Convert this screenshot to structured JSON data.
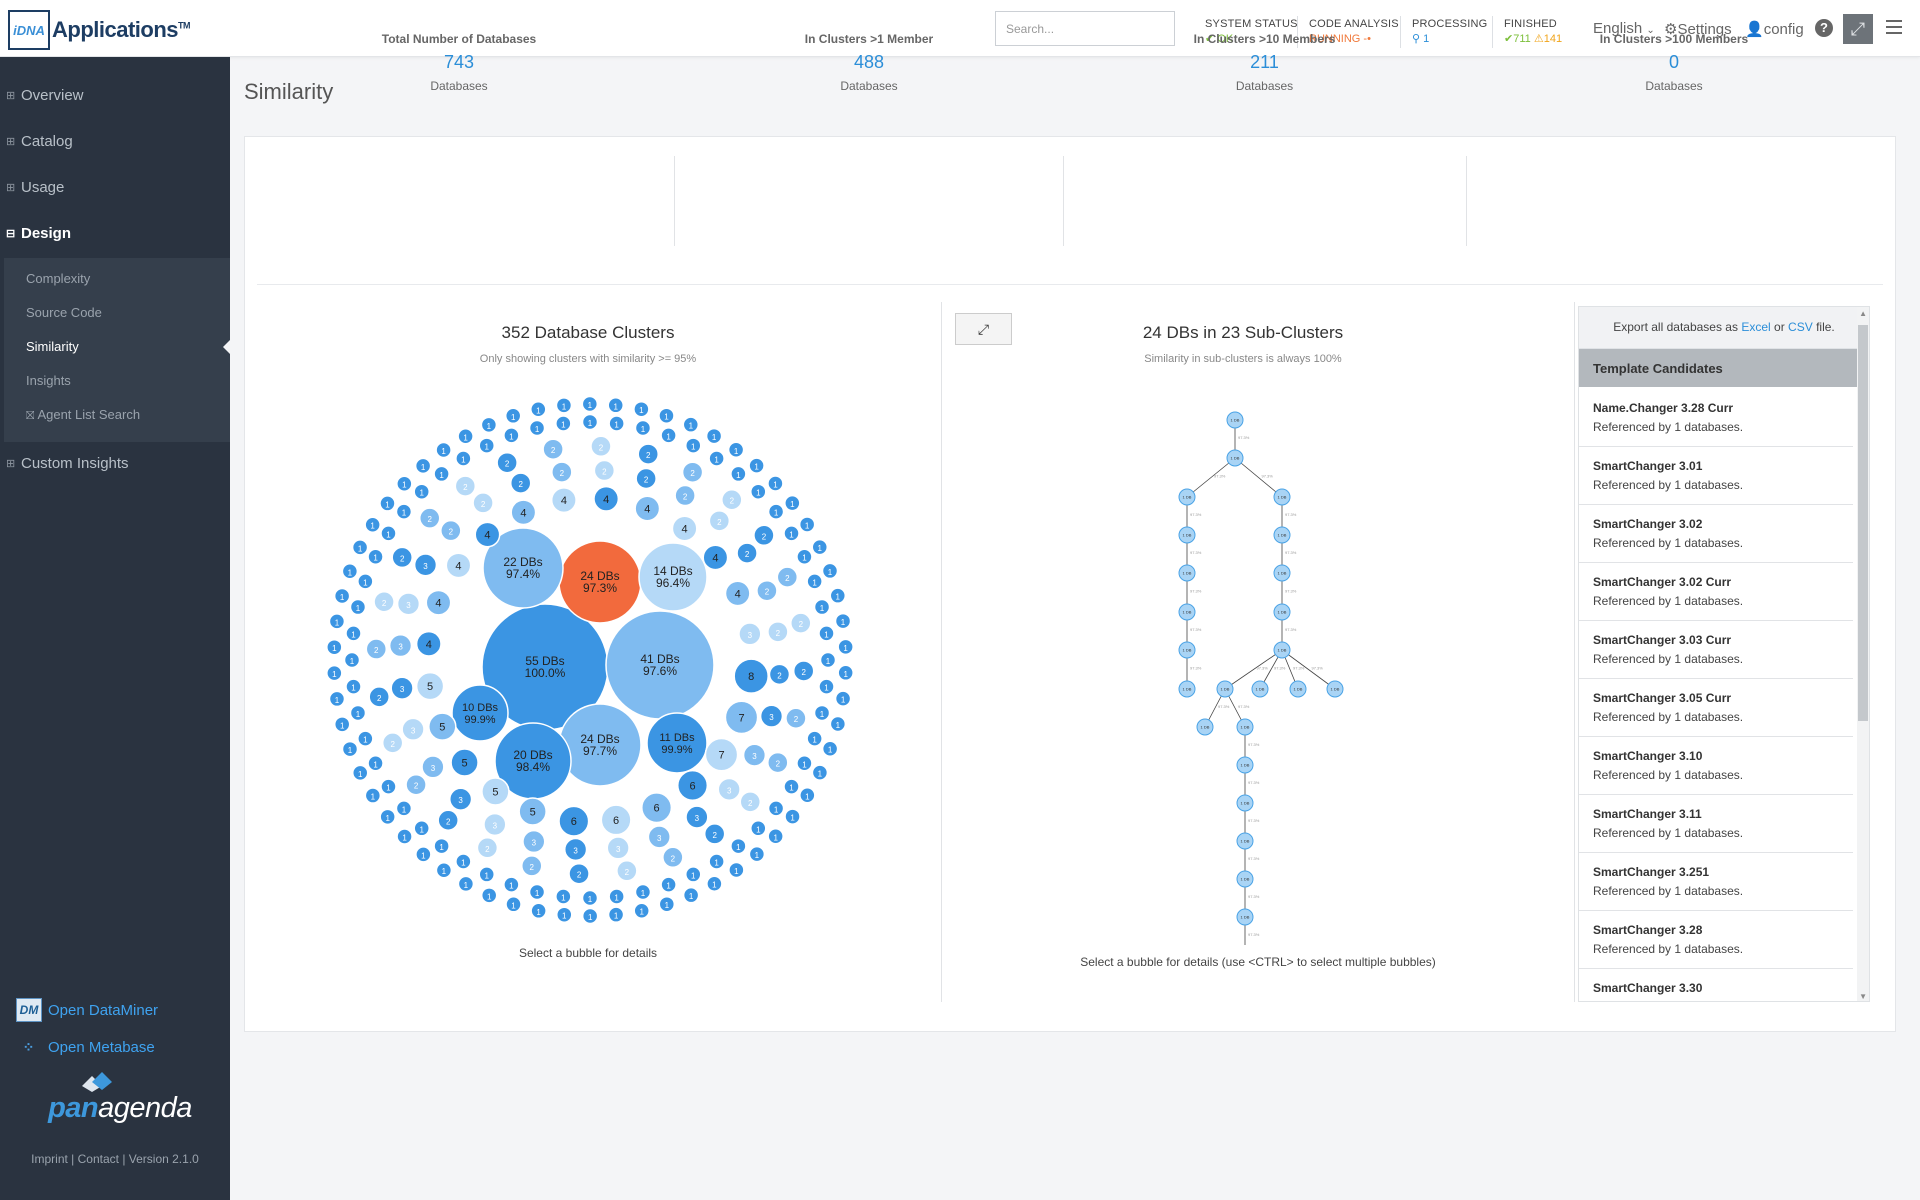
{
  "app": {
    "logo_mark": "iDNA",
    "name": "Applications",
    "tm": "TM"
  },
  "search": {
    "placeholder": "Search..."
  },
  "status": {
    "system": {
      "label": "SYSTEM STATUS",
      "value": "OK"
    },
    "code_analysis": {
      "label": "CODE ANALYSIS",
      "value": "RUNNING"
    },
    "processing": {
      "label": "PROCESSING",
      "value": "1"
    },
    "finished": {
      "label": "FINISHED",
      "ok_count": "711",
      "warn_count": "141"
    }
  },
  "header_links": {
    "language": "English",
    "settings": "Settings",
    "user": "config",
    "help": "?"
  },
  "sidebar": {
    "items": [
      {
        "label": "Overview",
        "state": "collapsed"
      },
      {
        "label": "Catalog",
        "state": "collapsed"
      },
      {
        "label": "Usage",
        "state": "collapsed"
      },
      {
        "label": "Design",
        "state": "expanded"
      },
      {
        "label": "Custom Insights",
        "state": "collapsed"
      }
    ],
    "design_sub": [
      "Complexity",
      "Source Code",
      "Similarity",
      "Insights",
      "Agent List Search"
    ],
    "open_dataminer": "Open DataMiner",
    "open_metabase": "Open Metabase",
    "brand": {
      "pan": "pan",
      "agenda": "agenda"
    },
    "footer": "Imprint | Contact | Version 2.1.0"
  },
  "page": {
    "title": "Similarity"
  },
  "stats": [
    {
      "title": "Total Number of Databases",
      "value": "743",
      "unit": "Databases"
    },
    {
      "title": "In Clusters >1 Member",
      "value": "488",
      "unit": "Databases"
    },
    {
      "title": "In Clusters >10 Members",
      "value": "211",
      "unit": "Databases"
    },
    {
      "title": "In Clusters >100 Members",
      "value": "0",
      "unit": "Databases"
    }
  ],
  "clusters": {
    "title": "352 Database Clusters",
    "subtitle": "Only showing clusters with similarity >= 95%",
    "hint": "Select a bubble for details",
    "big_bubbles": [
      {
        "label": "55 DBs",
        "pct": "100.0%"
      },
      {
        "label": "41 DBs",
        "pct": "97.6%"
      },
      {
        "label": "24 DBs",
        "pct": "97.3%"
      },
      {
        "label": "24 DBs",
        "pct": "97.7%"
      },
      {
        "label": "22 DBs",
        "pct": "97.4%"
      },
      {
        "label": "20 DBs",
        "pct": "98.4%"
      },
      {
        "label": "14 DBs",
        "pct": "96.4%"
      },
      {
        "label": "11 DBs",
        "pct": "99.9%"
      },
      {
        "label": "10 DBs",
        "pct": "99.9%"
      }
    ],
    "ring_counts": [
      "8",
      "7",
      "7",
      "6",
      "6",
      "6",
      "6",
      "5",
      "5",
      "5",
      "5",
      "5",
      "4",
      "4",
      "4",
      "4",
      "4",
      "4",
      "4",
      "4",
      "4",
      "4",
      "4",
      "3",
      "3",
      "3",
      "3",
      "3",
      "3",
      "3",
      "3",
      "3",
      "3",
      "3",
      "3",
      "3",
      "3",
      "3",
      "3",
      "3",
      "2",
      "2",
      "2",
      "2",
      "2",
      "2",
      "2",
      "2",
      "2",
      "2",
      "2",
      "2",
      "2",
      "2",
      "2",
      "2",
      "2",
      "2",
      "2",
      "2",
      "2",
      "2",
      "2",
      "2",
      "2",
      "2",
      "2",
      "2",
      "2",
      "2",
      "2",
      "2",
      "2",
      "2",
      "2",
      "2",
      "2",
      "2",
      "2",
      "2"
    ]
  },
  "subclusters": {
    "title": "24 DBs in 23 Sub-Clusters",
    "subtitle": "Similarity in sub-clusters is always 100%",
    "hint": "Select a bubble for details (use <CTRL> to select multiple bubbles)",
    "node_label": "1 DB",
    "edge_label": "97.3%"
  },
  "candidates": {
    "export_prefix": "Export all databases as",
    "excel": "Excel",
    "or": "or",
    "csv": "CSV",
    "export_suffix": "file.",
    "header": "Template Candidates",
    "items": [
      {
        "name": "Name.Changer 3.28 Curr",
        "ref": "Referenced by 1 databases."
      },
      {
        "name": "SmartChanger 3.01",
        "ref": "Referenced by 1 databases."
      },
      {
        "name": "SmartChanger 3.02",
        "ref": "Referenced by 1 databases."
      },
      {
        "name": "SmartChanger 3.02 Curr",
        "ref": "Referenced by 1 databases."
      },
      {
        "name": "SmartChanger 3.03 Curr",
        "ref": "Referenced by 1 databases."
      },
      {
        "name": "SmartChanger 3.05 Curr",
        "ref": "Referenced by 1 databases."
      },
      {
        "name": "SmartChanger 3.10",
        "ref": "Referenced by 1 databases."
      },
      {
        "name": "SmartChanger 3.11",
        "ref": "Referenced by 1 databases."
      },
      {
        "name": "SmartChanger 3.251",
        "ref": "Referenced by 1 databases."
      },
      {
        "name": "SmartChanger 3.28",
        "ref": "Referenced by 1 databases."
      },
      {
        "name": "SmartChanger 3.30",
        "ref": ""
      }
    ]
  },
  "colors": {
    "sidebar": "#2a3340",
    "accent": "#2b8ed8",
    "selected_bubble": "#f26a3d",
    "bubble_dark": "#3b95e3",
    "bubble_mid": "#7fbbf0",
    "bubble_light": "#b5d9f7"
  }
}
